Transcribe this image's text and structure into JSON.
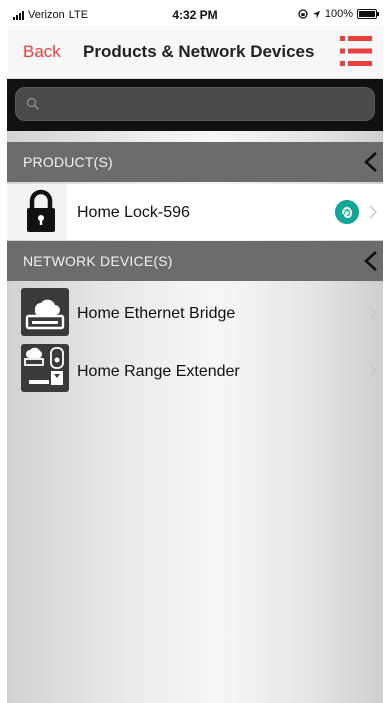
{
  "status_bar": {
    "carrier": "Verizon",
    "network": "LTE",
    "time": "4:32 PM",
    "battery": "100%",
    "battery_level": 1.0
  },
  "nav": {
    "back_label": "Back",
    "title": "Products & Network Devices",
    "menu_icon": "hamburger-menu-icon",
    "accent_color": "#e8403f"
  },
  "search": {
    "placeholder": "",
    "value": ""
  },
  "sections": {
    "products": {
      "header": "PRODUCT(S)",
      "items": [
        {
          "name": "Home Lock-596",
          "icon": "padlock-icon",
          "status_icon": "fingerprint-status-icon",
          "status_color": "#13a596"
        }
      ]
    },
    "network_devices": {
      "header": "NETWORK DEVICE(S)",
      "items": [
        {
          "name": "Home Ethernet Bridge",
          "icon": "ethernet-bridge-icon"
        },
        {
          "name": "Home Range Extender",
          "icon": "range-extender-icon"
        }
      ]
    }
  }
}
